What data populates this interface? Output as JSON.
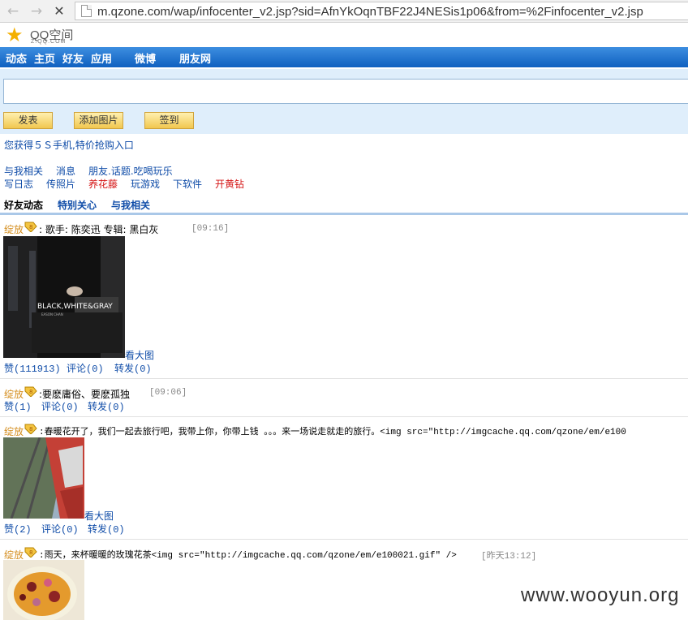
{
  "browser": {
    "url": "m.qzone.com/wap/infocenter_v2.jsp?sid=AfnYkOqnTBF22J4NESis1p06&from=%2Finfocenter_v2.jsp"
  },
  "logo": {
    "main": "QQ空间",
    "sub": "Z.QQ.COM"
  },
  "menu": [
    "动态",
    "主页",
    "好友",
    "应用",
    "微博",
    "朋友网"
  ],
  "compose": {
    "buttons": [
      "发表",
      "添加图片",
      "签到"
    ]
  },
  "promo": "您获得５Ｓ手机,特价抢购入口",
  "links_row1": [
    "与我相关",
    "消息",
    "朋友.话题.吃喝玩乐"
  ],
  "links_row2": [
    "写日志",
    "传照片",
    "养花藤",
    "玩游戏",
    "下软件",
    "开黄钻"
  ],
  "tabs": [
    "好友动态",
    "特别关心",
    "与我相关"
  ],
  "feed": [
    {
      "name": "绽放",
      "text": "歌手: 陈奕迅 专辑: 黑白灰",
      "time": "[09:16]",
      "image_text": "BLACK,WHITE&GRAY",
      "image_caption": "EASON CHAN",
      "view_large": "看大图",
      "actions": [
        "赞(111913)",
        "评论(0)",
        "转发(0)"
      ]
    },
    {
      "name": "绽放",
      "text": ":要麽庸俗、要麽孤独",
      "time": "[09:06]",
      "actions": [
        "赞(1)",
        "评论(0)",
        "转发(0)"
      ]
    },
    {
      "name": "绽放",
      "text": ":春暖花开了，我们一起去旅行吧，我带上你，你带上钱 。。。来一场说走就走的旅行。<img src=\"http://imgcache.qq.com/qzone/em/e100",
      "view_large": "看大图",
      "actions": [
        "赞(2)",
        "评论(0)",
        "转发(0)"
      ]
    },
    {
      "name": "绽放",
      "text": ":雨天，来杯暖暖的玫瑰花茶<img src=\"http://imgcache.qq.com/qzone/em/e100021.gif\" />",
      "time": "[昨天13:12]"
    }
  ],
  "watermark": "www.wooyun.org",
  "colors": {
    "menu_top": "#3d8ee0",
    "menu_bottom": "#0f60c0",
    "link": "#0f4ca8",
    "name": "#d48d1d",
    "red": "#d51616"
  }
}
